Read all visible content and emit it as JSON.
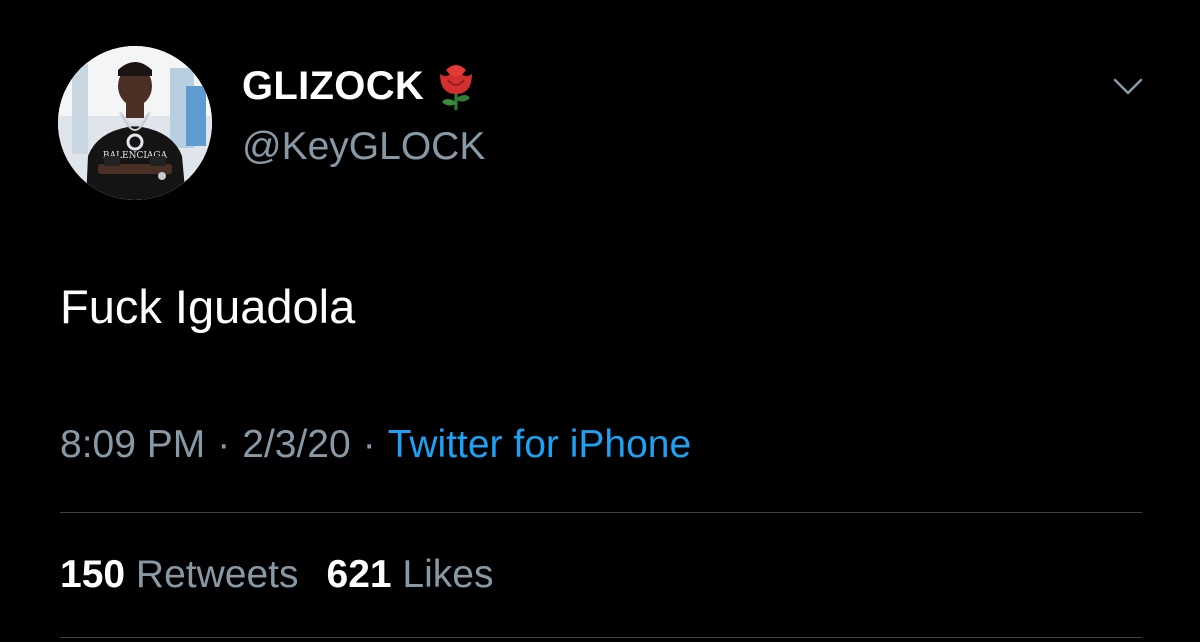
{
  "author": {
    "display_name": "GLIZOCK",
    "name_emoji_icon": "rose-icon",
    "handle": "@KeyGLOCK",
    "avatar_shirt_text": "BALENCIAGA"
  },
  "tweet": {
    "text": "Fuck Iguadola",
    "time": "8:09 PM",
    "date": "2/3/20",
    "separator": "·",
    "source": "Twitter for iPhone"
  },
  "stats": {
    "retweets_count": "150",
    "retweets_label": "Retweets",
    "likes_count": "621",
    "likes_label": "Likes"
  },
  "colors": {
    "background": "#000000",
    "primary_text": "#ffffff",
    "secondary_text": "#8899a6",
    "link": "#1da1f2",
    "divider": "#38444d"
  },
  "icons": {
    "more_menu": "chevron-down-icon"
  }
}
